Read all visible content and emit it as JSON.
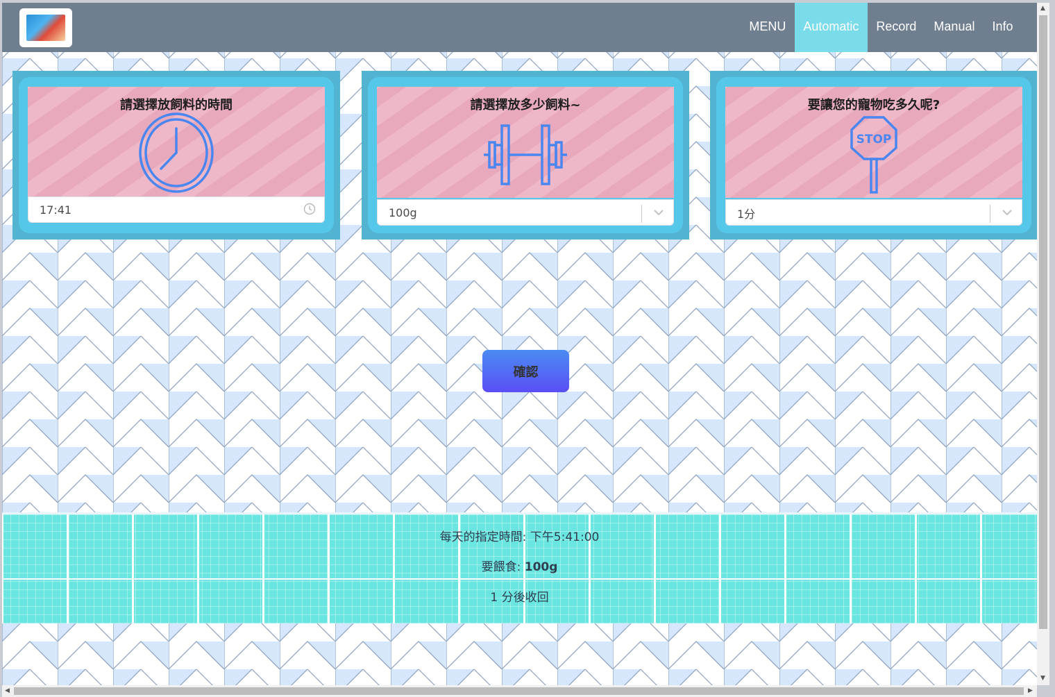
{
  "nav": {
    "items": [
      {
        "label": "MENU",
        "active": false
      },
      {
        "label": "Automatic",
        "active": true
      },
      {
        "label": "Record",
        "active": false
      },
      {
        "label": "Manual",
        "active": false
      },
      {
        "label": "Info",
        "active": false
      }
    ]
  },
  "cards": {
    "time": {
      "title": "請選擇放飼料的時間",
      "value": "17:41",
      "icon": "clock-icon"
    },
    "amount": {
      "title": "請選擇放多少飼料~",
      "value": "100g",
      "icon": "dumbbell-icon"
    },
    "duration": {
      "title": "要讓您的寵物吃多久呢?",
      "value": "1分",
      "icon": "stop-sign-icon",
      "sign_text": "STOP"
    }
  },
  "confirm": {
    "label": "確認"
  },
  "summary": {
    "time_label": "每天的指定時間: ",
    "time_value": "下午5:41:00",
    "feed_label": "要餵食: ",
    "feed_value": "100g",
    "retract_text": "1 分後收回"
  },
  "colors": {
    "navbar": "#707f90",
    "nav_active": "#7adbeb",
    "card_frame": "#55c8ea",
    "button": "#5b6cf3",
    "panel": "#6ae6e0"
  }
}
